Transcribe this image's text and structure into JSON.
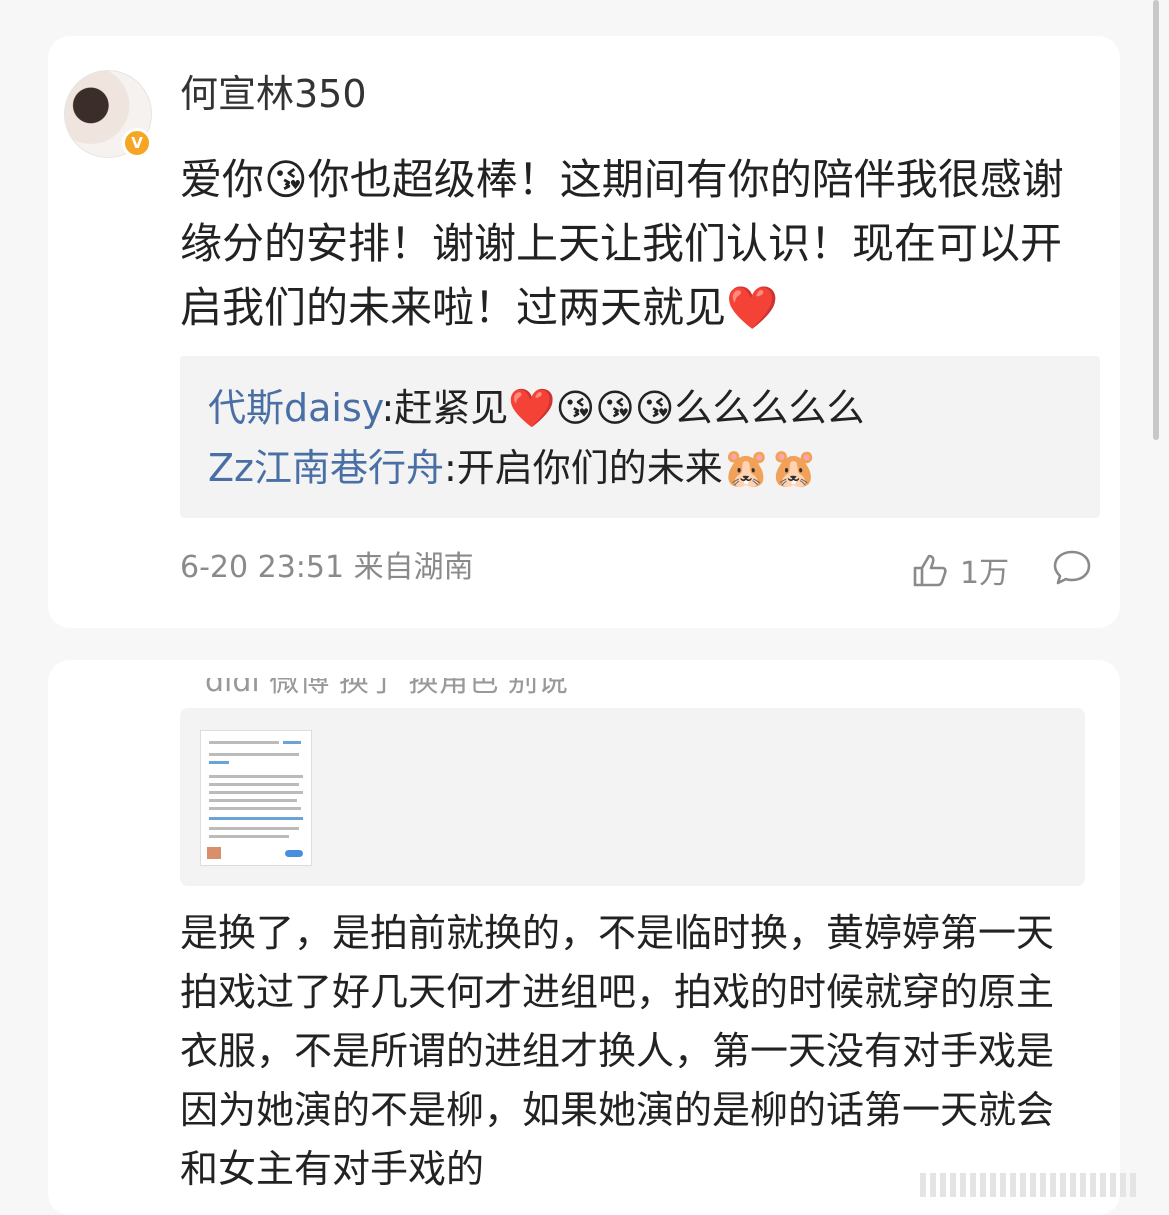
{
  "post": {
    "username": "何宣林350",
    "avatar_badge": "V",
    "text": "爱你😘你也超级棒！这期间有你的陪伴我很感谢缘分的安排！谢谢上天让我们认识！现在可以开启我们的未来啦！过两天就见❤️",
    "replies": [
      {
        "user": "代斯daisy",
        "text": ":赶紧见❤️😘😘😘么么么么么"
      },
      {
        "user": "Zz江南巷行舟",
        "text": ":开启你们的未来🐹🐹"
      }
    ],
    "timestamp": "6-20 23:51 来自湖南",
    "like_count": "1万"
  },
  "comment": {
    "cut_top_text": "didi 微博 换了 换角色 别说",
    "text": "是换了，是拍前就换的，不是临时换，黄婷婷第一天拍戏过了好几天何才进组吧，拍戏的时候就穿的原主衣服，不是所谓的进组才换人，第一天没有对手戏是因为她演的不是柳，如果她演的是柳的话第一天就会和女主有对手戏的"
  },
  "colors": {
    "link": "#4a6fa5",
    "meta": "#8a8a8a",
    "badge": "#f6a623"
  }
}
